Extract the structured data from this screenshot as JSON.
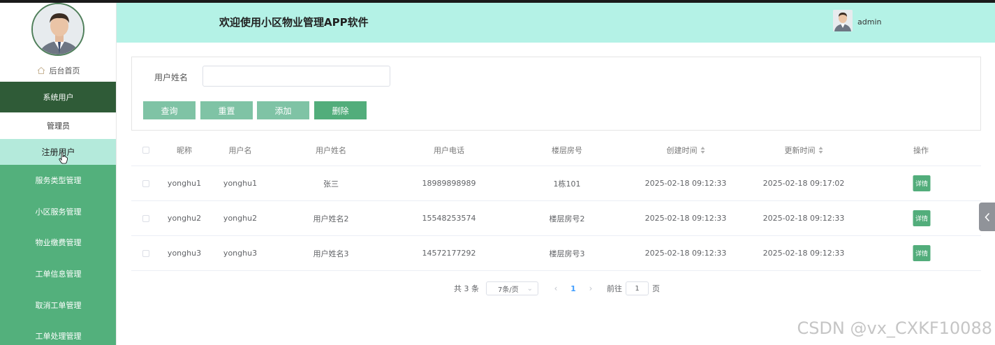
{
  "app": {
    "title": "欢迎使用小区物业管理APP软件"
  },
  "user": {
    "name": "admin"
  },
  "sidebar": {
    "home_label": "后台首页",
    "group_label": "系统用户",
    "sub_items": [
      {
        "label": "管理员"
      },
      {
        "label": "注册用户"
      }
    ],
    "items": [
      {
        "label": "服务类型管理"
      },
      {
        "label": "小区服务管理"
      },
      {
        "label": "物业缴费管理"
      },
      {
        "label": "工单信息管理"
      },
      {
        "label": "取消工单管理"
      },
      {
        "label": "工单处理管理"
      }
    ]
  },
  "search": {
    "field_label": "用户姓名",
    "field_value": "",
    "buttons": {
      "search": "查询",
      "reset": "重置",
      "add": "添加",
      "delete": "删除"
    }
  },
  "table": {
    "headers": [
      "昵称",
      "用户名",
      "用户姓名",
      "用户电话",
      "楼层房号",
      "创建时间",
      "更新时间",
      "操作"
    ],
    "rows": [
      {
        "nickname": "yonghu1",
        "username": "yonghu1",
        "realname": "张三",
        "phone": "18989898989",
        "room": "1栋101",
        "created": "2025-02-18 09:12:33",
        "updated": "2025-02-18 09:17:02",
        "action": "详情"
      },
      {
        "nickname": "yonghu2",
        "username": "yonghu2",
        "realname": "用户姓名2",
        "phone": "15548253574",
        "room": "楼层房号2",
        "created": "2025-02-18 09:12:33",
        "updated": "2025-02-18 09:12:33",
        "action": "详情"
      },
      {
        "nickname": "yonghu3",
        "username": "yonghu3",
        "realname": "用户姓名3",
        "phone": "14572177292",
        "room": "楼层房号3",
        "created": "2025-02-18 09:12:33",
        "updated": "2025-02-18 09:12:33",
        "action": "详情"
      }
    ]
  },
  "pagination": {
    "total": "共 3 条",
    "page_size": "7条/页",
    "current_page": "1",
    "goto_label": "前往",
    "goto_value": "1",
    "page_suffix": "页"
  },
  "watermark": "CSDN @vx_CXKF10088",
  "colors": {
    "header_bg": "#b4f2e6",
    "sidebar_group": "#2f5b37",
    "sidebar_menu": "#53b07c",
    "sidebar_active": "#b4eadb",
    "button_light": "#7fc3a5",
    "button_primary": "#52ad7b"
  },
  "icons": {
    "home": "home-icon",
    "sort": "sort-icon",
    "collapse": "chevron-left-icon",
    "cursor": "hand-pointer-icon"
  }
}
